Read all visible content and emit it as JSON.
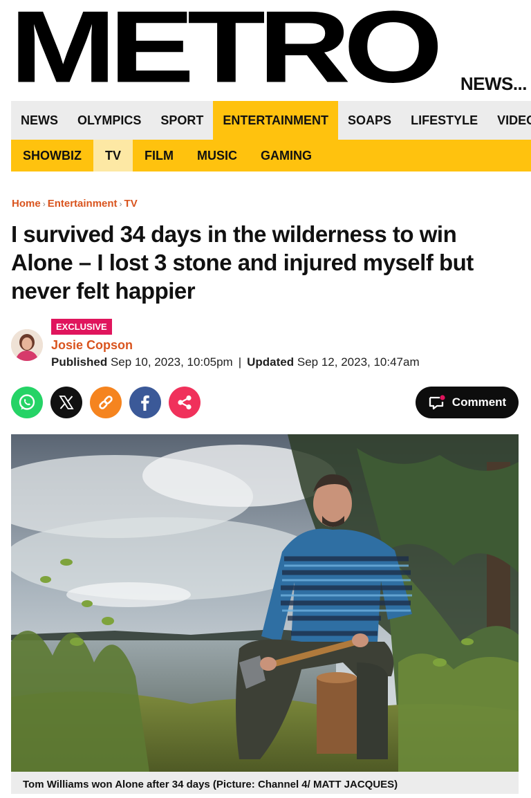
{
  "masthead": {
    "logo": "METRO",
    "news_link": "NEWS..."
  },
  "nav_primary": [
    "NEWS",
    "OLYMPICS",
    "SPORT",
    "ENTERTAINMENT",
    "SOAPS",
    "LIFESTYLE",
    "VIDEO"
  ],
  "nav_primary_active": "ENTERTAINMENT",
  "nav_secondary": [
    "SHOWBIZ",
    "TV",
    "FILM",
    "MUSIC",
    "GAMING"
  ],
  "nav_secondary_active": "TV",
  "breadcrumb": [
    "Home",
    "Entertainment",
    "TV"
  ],
  "headline": "I survived 34 days in the wilderness to win Alone – I lost 3 stone and injured myself but never felt happier",
  "byline": {
    "badge": "EXCLUSIVE",
    "author": "Josie Copson",
    "published_label": "Published",
    "published": "Sep 10, 2023, 10:05pm",
    "separator": "|",
    "updated_label": "Updated",
    "updated": "Sep 12, 2023, 10:47am"
  },
  "share": {
    "icons": [
      "whatsapp-icon",
      "x-icon",
      "link-icon",
      "facebook-icon",
      "share-icon"
    ],
    "comment_label": "Comment"
  },
  "caption": "Tom Williams won Alone after 34 days (Picture: Channel 4/ MATT JACQUES)",
  "colors": {
    "accent": "#ffc20e",
    "link_orange": "#d9541e",
    "badge": "#e0155d",
    "whatsapp": "#25d366",
    "link": "#f5841f",
    "facebook": "#3b5998",
    "share": "#f0315b"
  }
}
